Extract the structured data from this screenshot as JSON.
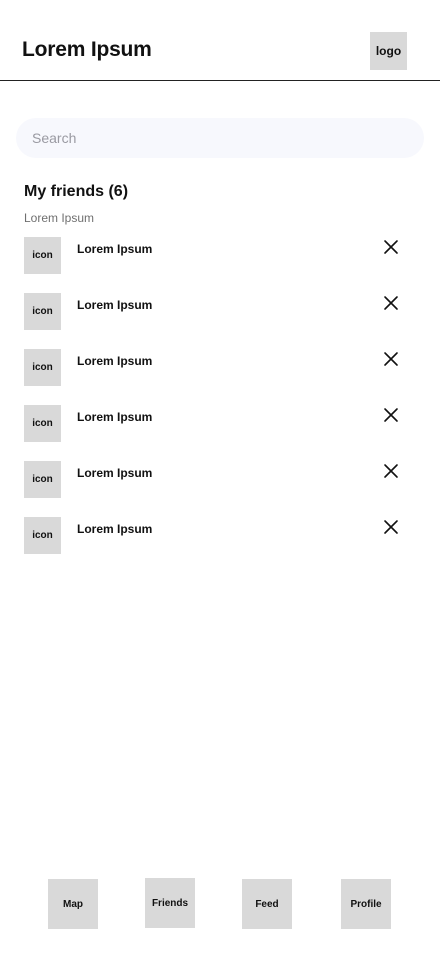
{
  "header": {
    "title": "Lorem Ipsum",
    "logo_label": "logo"
  },
  "search": {
    "placeholder": "Search",
    "value": ""
  },
  "friends": {
    "title": "My friends (6)",
    "subtitle": "Lorem Ipsum",
    "items": [
      {
        "icon_label": "icon",
        "name": "Lorem Ipsum"
      },
      {
        "icon_label": "icon",
        "name": "Lorem Ipsum"
      },
      {
        "icon_label": "icon",
        "name": "Lorem Ipsum"
      },
      {
        "icon_label": "icon",
        "name": "Lorem Ipsum"
      },
      {
        "icon_label": "icon",
        "name": "Lorem Ipsum"
      },
      {
        "icon_label": "icon",
        "name": "Lorem Ipsum"
      }
    ],
    "remove_icon": "close-icon"
  },
  "bottom_nav": {
    "items": [
      {
        "label": "Map"
      },
      {
        "label": "Friends"
      },
      {
        "label": "Feed"
      },
      {
        "label": "Profile"
      }
    ]
  },
  "colors": {
    "placeholder_box": "#d9d9d9",
    "search_background": "#f7f8fd",
    "divider": "#222222",
    "subtitle_text": "#6f6f6f"
  }
}
